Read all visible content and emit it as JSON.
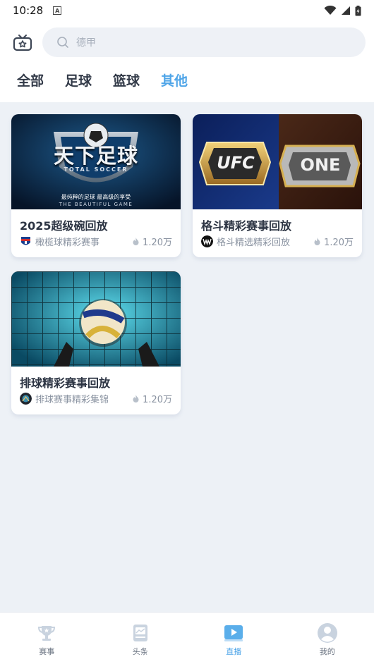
{
  "status": {
    "time": "10:28",
    "indicator": "A"
  },
  "search": {
    "placeholder": "德甲"
  },
  "tabs": [
    {
      "label": "全部",
      "active": false
    },
    {
      "label": "足球",
      "active": false
    },
    {
      "label": "篮球",
      "active": false
    },
    {
      "label": "其他",
      "active": true
    }
  ],
  "cards": [
    {
      "title": "2025超级碗回放",
      "source": "橄榄球精彩赛事",
      "views": "1.20万",
      "thumb_text": {
        "logo": "天下足球",
        "logo_sub": "TOTAL SOCCER",
        "tagline": "最纯粹的足球 最高级的享受",
        "tagline_en": "THE BEAUTIFUL GAME"
      }
    },
    {
      "title": "格斗精彩赛事回放",
      "source": "格斗精选精彩回放",
      "views": "1.20万",
      "thumb_text": {
        "left_belt": "UFC",
        "right_belt": "ONE"
      }
    },
    {
      "title": "排球精彩赛事回放",
      "source": "排球赛事精彩集锦",
      "views": "1.20万"
    }
  ],
  "nav": [
    {
      "label": "赛事",
      "icon": "trophy-icon"
    },
    {
      "label": "头条",
      "icon": "news-icon"
    },
    {
      "label": "直播",
      "icon": "play-icon",
      "active": true
    },
    {
      "label": "我的",
      "icon": "user-icon"
    }
  ],
  "colors": {
    "accent": "#4fa5e8",
    "background": "#edf1f6"
  }
}
